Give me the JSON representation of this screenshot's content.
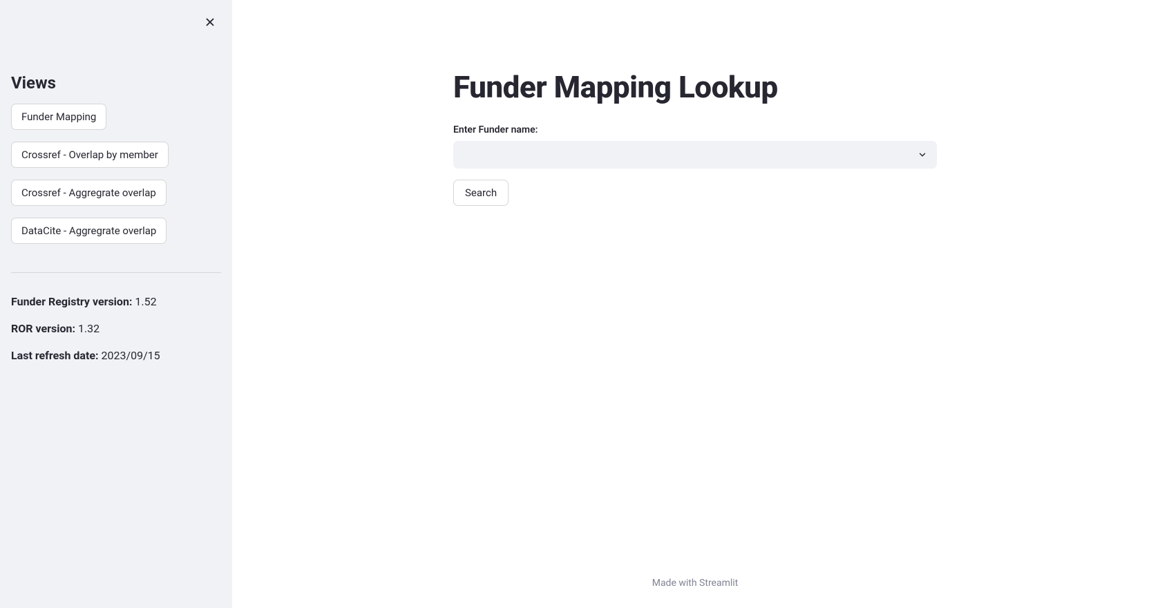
{
  "sidebar": {
    "heading": "Views",
    "views": [
      "Funder Mapping",
      "Crossref - Overlap by member",
      "Crossref - Aggregrate overlap",
      "DataCite - Aggregrate overlap"
    ],
    "info": {
      "funder_registry_label": "Funder Registry version:",
      "funder_registry_value": " 1.52",
      "ror_label": "ROR version:",
      "ror_value": " 1.32",
      "refresh_label": "Last refresh date:",
      "refresh_value": " 2023/09/15"
    }
  },
  "main": {
    "title": "Funder Mapping Lookup",
    "input_label": "Enter Funder name:",
    "select_value": "",
    "search_button": "Search"
  },
  "footer": {
    "prefix": "Made with ",
    "link": "Streamlit"
  }
}
